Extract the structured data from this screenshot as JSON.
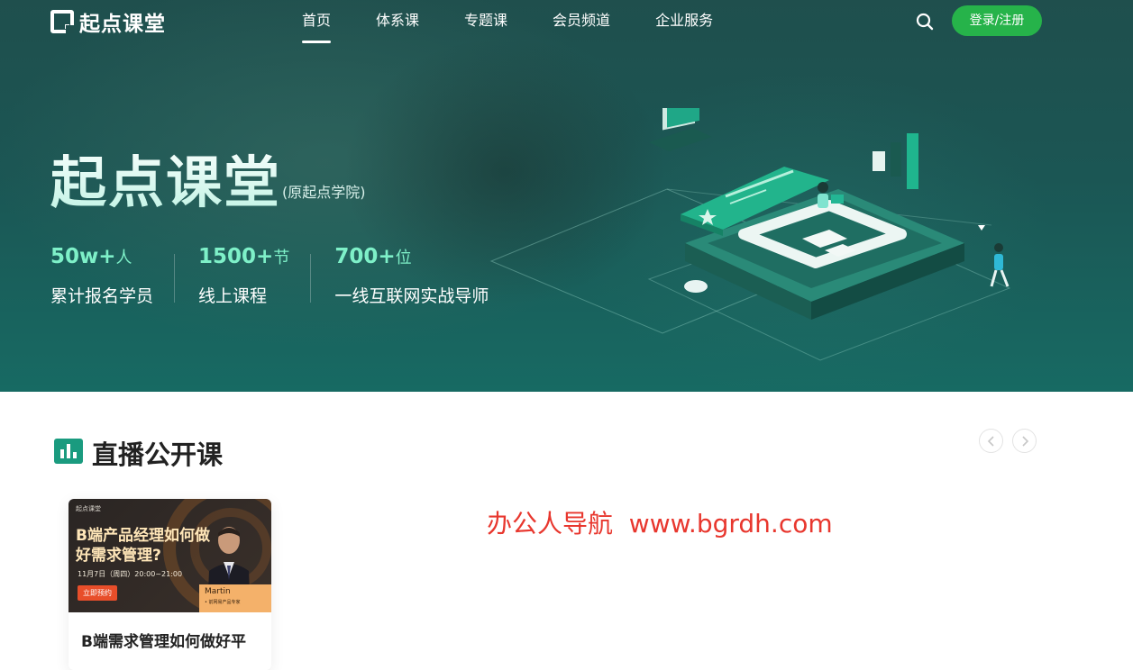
{
  "header": {
    "logo_text": "起点课堂",
    "nav": [
      {
        "label": "首页",
        "active": true
      },
      {
        "label": "体系课",
        "active": false
      },
      {
        "label": "专题课",
        "active": false
      },
      {
        "label": "会员频道",
        "active": false
      },
      {
        "label": "企业服务",
        "active": false
      }
    ],
    "search_icon": "search-icon",
    "login_label": "登录/注册",
    "login_color": "#26b34a"
  },
  "hero": {
    "title": "起点课堂",
    "subtitle": "(原起点学院)",
    "stats": [
      {
        "number": "50w+",
        "unit": "人",
        "label": "累计报名学员"
      },
      {
        "number": "1500+",
        "unit": "节",
        "label": "线上课程"
      },
      {
        "number": "700+",
        "unit": "位",
        "label": "一线互联网实战导师"
      }
    ],
    "accent_color": "#7ef0c8"
  },
  "section": {
    "title": "直播公开课",
    "icon": "bar-chart-icon",
    "prev_icon": "chevron-left-icon",
    "next_icon": "chevron-right-icon"
  },
  "cards": [
    {
      "thumb_brand": "起点课堂",
      "thumb_title": "B端产品经理如何做好需求管理?",
      "thumb_time": "11月7日（周四）20:00~21:00",
      "thumb_button": "立即预约",
      "speaker_name": "Martin",
      "speaker_title": "• 前网易产品专家",
      "title": "B端需求管理如何做好平"
    }
  ],
  "watermark": "办公人导航  www.bgrdh.com"
}
